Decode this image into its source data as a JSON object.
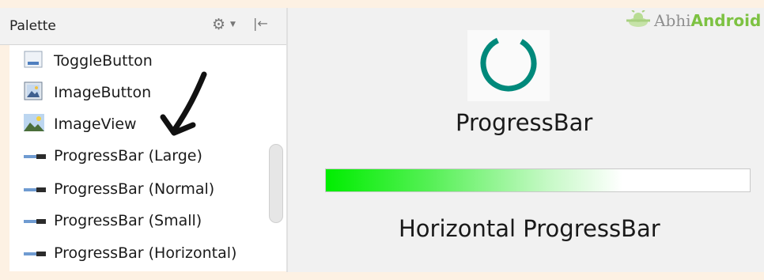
{
  "palette": {
    "title": "Palette",
    "items": [
      {
        "label": "ToggleButton",
        "icon": "toggle-button-icon"
      },
      {
        "label": "ImageButton",
        "icon": "image-button-icon"
      },
      {
        "label": "ImageView",
        "icon": "image-view-icon"
      },
      {
        "label": "ProgressBar (Large)",
        "icon": "progressbar-icon"
      },
      {
        "label": "ProgressBar (Normal)",
        "icon": "progressbar-icon"
      },
      {
        "label": "ProgressBar (Small)",
        "icon": "progressbar-icon"
      },
      {
        "label": "ProgressBar (Horizontal)",
        "icon": "progressbar-icon"
      }
    ]
  },
  "preview": {
    "progressbar_label": "ProgressBar",
    "horizontal_label": "Horizontal ProgressBar",
    "spinner_color": "#00897b",
    "horizontal_progress": 0.7
  },
  "logo": {
    "part1": "Abhi",
    "part2": "Android",
    "green": "#7dc242"
  }
}
